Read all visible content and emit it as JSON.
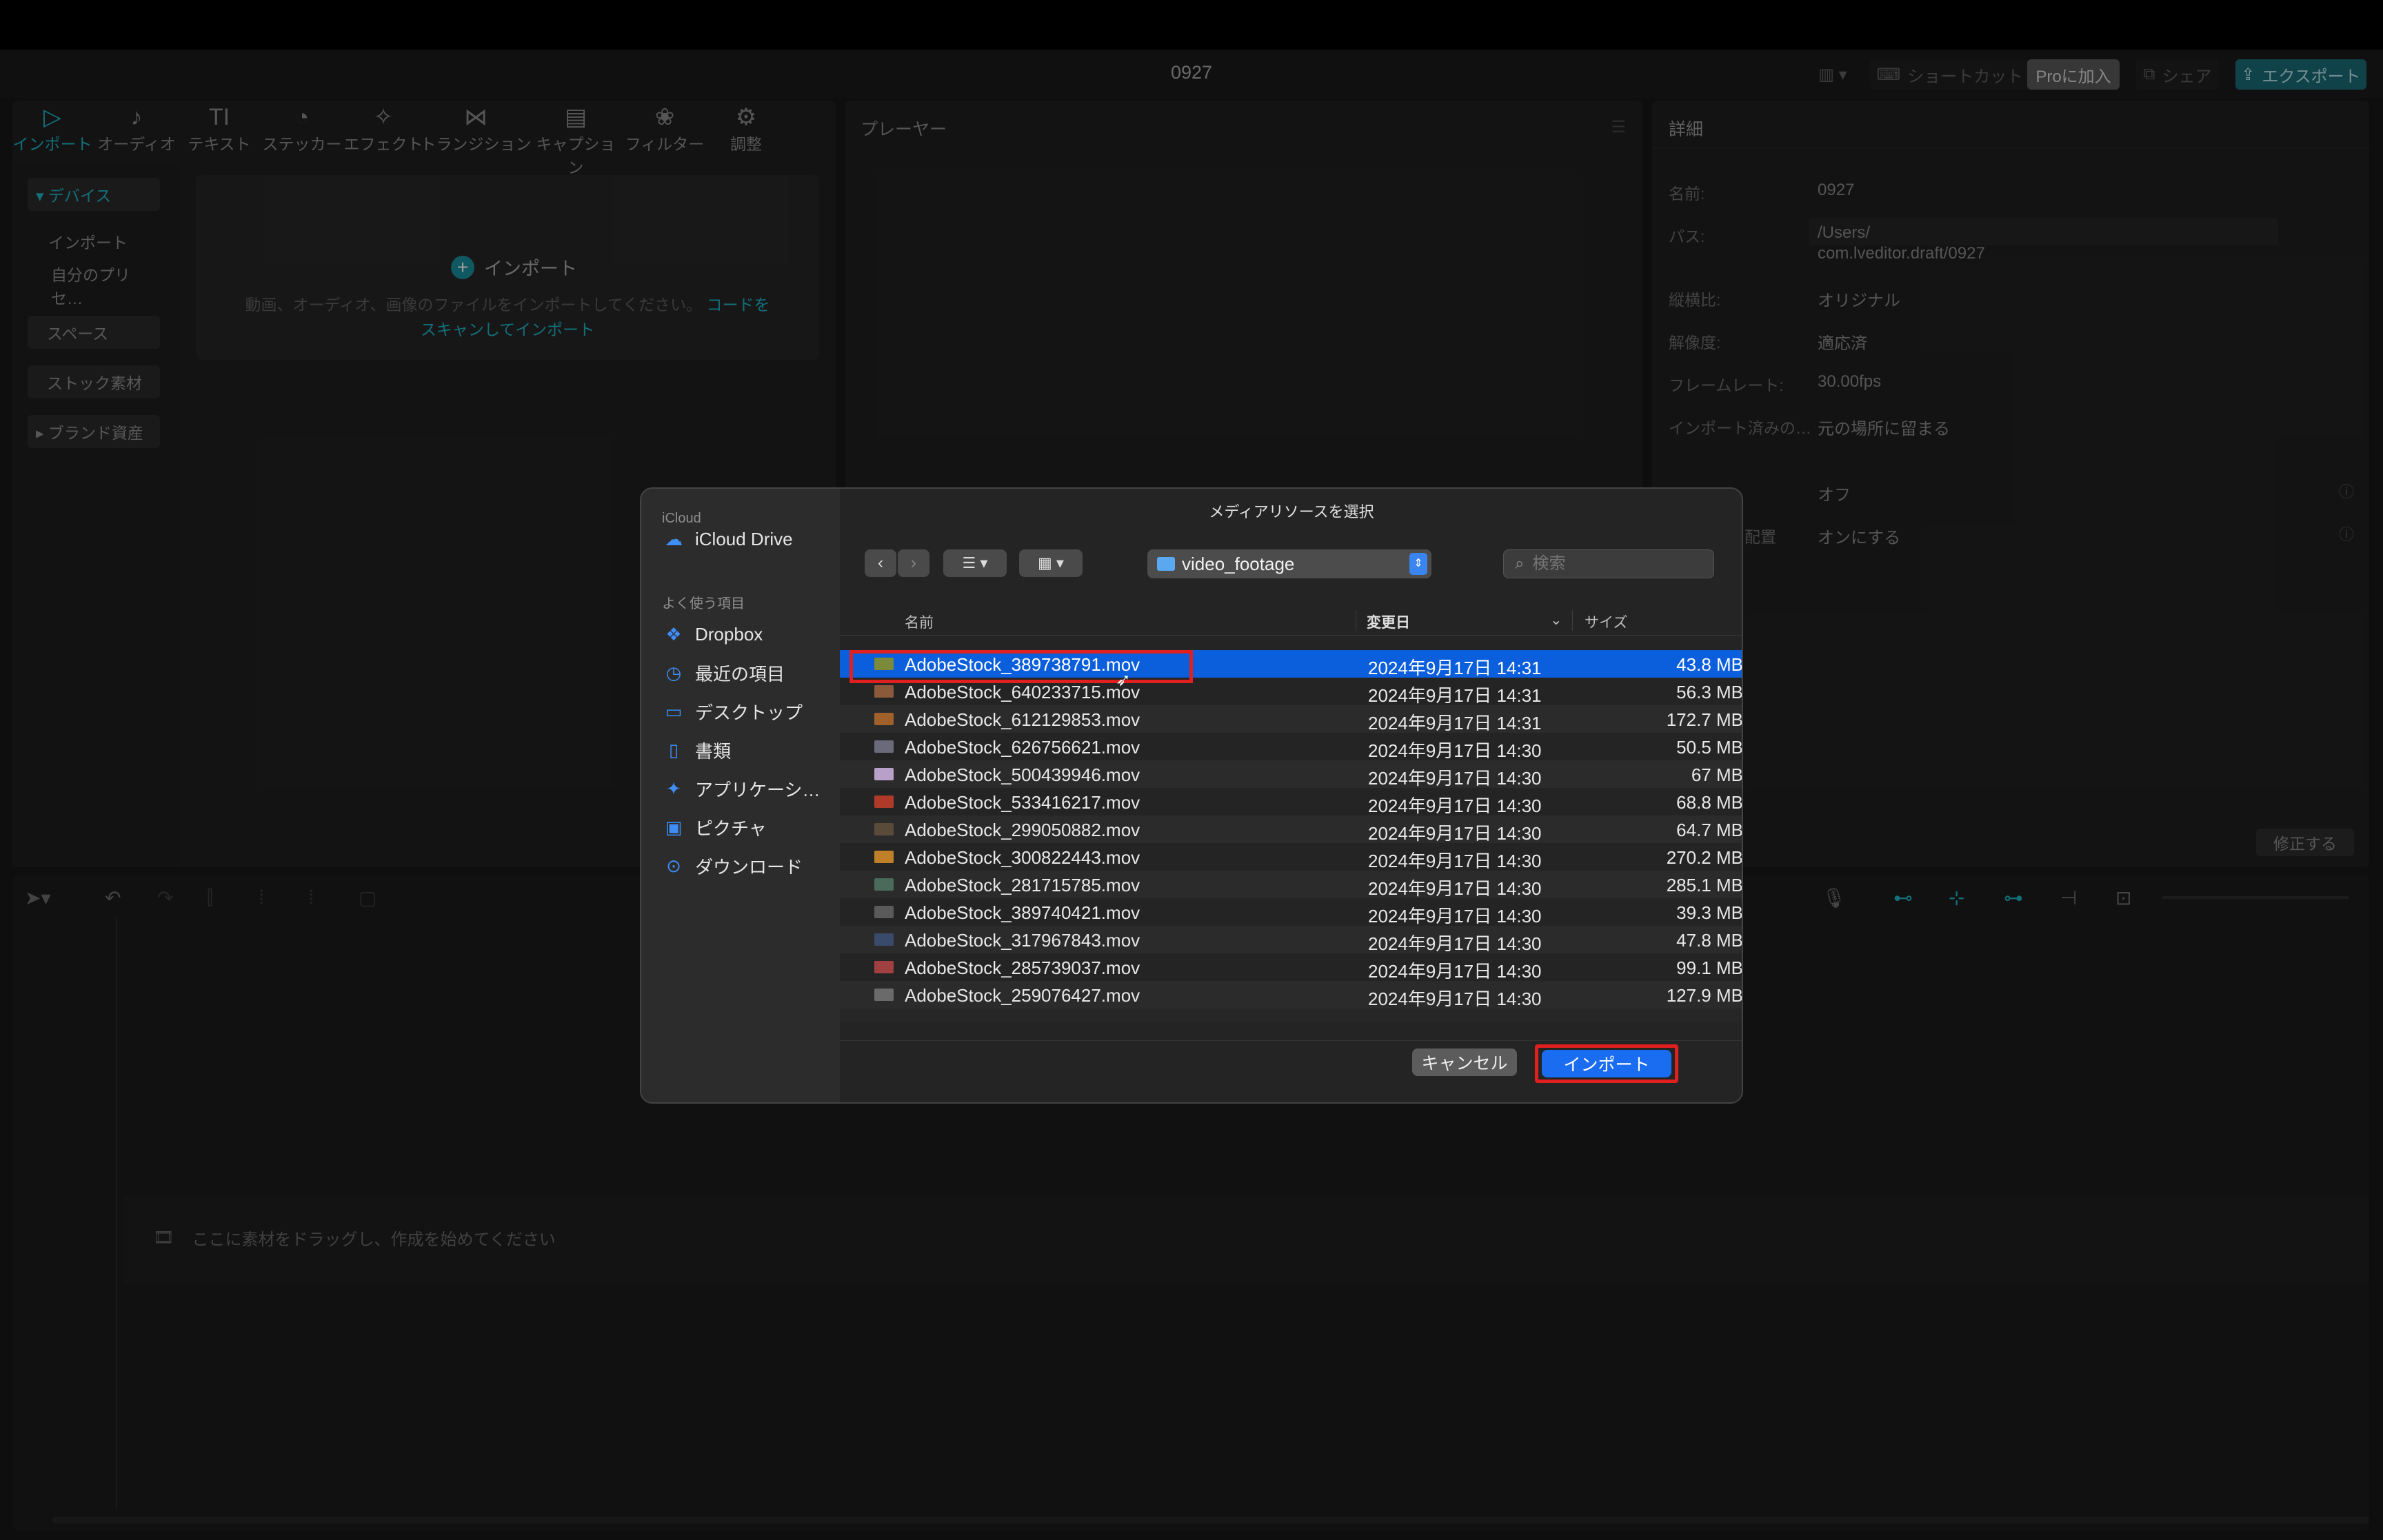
{
  "window": {
    "title": "0927"
  },
  "header": {
    "layout_icon": "layout-icon",
    "shortcut_label": "ショートカット",
    "pro_label": "Proに加入",
    "share_label": "シェア",
    "export_label": "エクスポート"
  },
  "toolbar": {
    "tools": [
      {
        "label": "インポート",
        "icon": "▷"
      },
      {
        "label": "オーディオ",
        "icon": "♪"
      },
      {
        "label": "テキスト",
        "icon": "TI"
      },
      {
        "label": "ステッカー",
        "icon": "◔"
      },
      {
        "label": "エフェクト",
        "icon": "✧"
      },
      {
        "label": "トランジション",
        "icon": "⋈"
      },
      {
        "label": "キャプション",
        "icon": "▤"
      },
      {
        "label": "フィルター",
        "icon": "❀"
      },
      {
        "label": "調整",
        "icon": "⚙"
      }
    ]
  },
  "sidebar": {
    "items": [
      {
        "label": "▾ デバイス"
      },
      {
        "label": "インポート"
      },
      {
        "label": "自分のプリセ…"
      },
      {
        "label": "スペース"
      },
      {
        "label": "ストック素材"
      },
      {
        "label": "▸ ブランド資産"
      }
    ]
  },
  "import_area": {
    "button_label": "インポート",
    "hint": "動画、オーディオ、画像のファイルをインポートしてください。",
    "link": "コードをスキャンしてインポート"
  },
  "player": {
    "title": "プレーヤー"
  },
  "details": {
    "title": "詳細",
    "rows": [
      {
        "label": "名前:",
        "value": "0927"
      },
      {
        "label": "パス:",
        "value": "/Users/",
        "value2": "com.lveditor.draft/0927"
      },
      {
        "label": "縦横比:",
        "value": "オリジナル"
      },
      {
        "label": "解像度:",
        "value": "適応済"
      },
      {
        "label": "フレームレート:",
        "value": "30.00fps"
      },
      {
        "label": "インポート済みの…",
        "value": "元の場所に留まる"
      },
      {
        "label": "",
        "value": "オフ"
      },
      {
        "label": "配置",
        "value": "オンにする"
      }
    ],
    "modify_label": "修正する"
  },
  "timeline": {
    "drop_hint": "ここに素材をドラッグし、作成を始めてください"
  },
  "dialog": {
    "title": "メディアリソースを選択",
    "side": {
      "icloud_header": "iCloud",
      "icloud_drive": "iCloud Drive",
      "favorites_header": "よく使う項目",
      "favorites": [
        {
          "label": "Dropbox",
          "icon": "dropbox-icon",
          "glyph": "❖"
        },
        {
          "label": "最近の項目",
          "icon": "clock-icon",
          "glyph": "◷"
        },
        {
          "label": "デスクトップ",
          "icon": "desktop-icon",
          "glyph": "▭"
        },
        {
          "label": "書類",
          "icon": "document-icon",
          "glyph": "▯"
        },
        {
          "label": "アプリケーシ…",
          "icon": "applications-icon",
          "glyph": "✦"
        },
        {
          "label": "ピクチャ",
          "icon": "pictures-icon",
          "glyph": "▣"
        },
        {
          "label": "ダウンロード",
          "icon": "download-icon",
          "glyph": "⊙"
        }
      ]
    },
    "folder": "video_footage",
    "search_placeholder": "検索",
    "columns": {
      "name": "名前",
      "date": "変更日",
      "size": "サイズ"
    },
    "files": [
      {
        "name": "AdobeStock_389738791.mov",
        "date": "2024年9月17日 14:31",
        "size": "43.8 MB",
        "color": "#7a8a3a"
      },
      {
        "name": "AdobeStock_640233715.mov",
        "date": "2024年9月17日 14:31",
        "size": "56.3 MB",
        "color": "#8a5a3a"
      },
      {
        "name": "AdobeStock_612129853.mov",
        "date": "2024年9月17日 14:31",
        "size": "172.7 MB",
        "color": "#a0602a"
      },
      {
        "name": "AdobeStock_626756621.mov",
        "date": "2024年9月17日 14:30",
        "size": "50.5 MB",
        "color": "#6a6a7a"
      },
      {
        "name": "AdobeStock_500439946.mov",
        "date": "2024年9月17日 14:30",
        "size": "67 MB",
        "color": "#b8a0c8"
      },
      {
        "name": "AdobeStock_533416217.mov",
        "date": "2024年9月17日 14:30",
        "size": "68.8 MB",
        "color": "#b03a2a"
      },
      {
        "name": "AdobeStock_299050882.mov",
        "date": "2024年9月17日 14:30",
        "size": "64.7 MB",
        "color": "#5a4a3a"
      },
      {
        "name": "AdobeStock_300822443.mov",
        "date": "2024年9月17日 14:30",
        "size": "270.2 MB",
        "color": "#c0802a"
      },
      {
        "name": "AdobeStock_281715785.mov",
        "date": "2024年9月17日 14:30",
        "size": "285.1 MB",
        "color": "#4a6a5a"
      },
      {
        "name": "AdobeStock_389740421.mov",
        "date": "2024年9月17日 14:30",
        "size": "39.3 MB",
        "color": "#5a5a5a"
      },
      {
        "name": "AdobeStock_317967843.mov",
        "date": "2024年9月17日 14:30",
        "size": "47.8 MB",
        "color": "#3a4a6a"
      },
      {
        "name": "AdobeStock_285739037.mov",
        "date": "2024年9月17日 14:30",
        "size": "99.1 MB",
        "color": "#a04040"
      },
      {
        "name": "AdobeStock_259076427.mov",
        "date": "2024年9月17日 14:30",
        "size": "127.9 MB",
        "color": "#6a6a6a"
      }
    ],
    "cancel_label": "キャンセル",
    "import_label": "インポート"
  },
  "colors": {
    "accent": "#1fb4c6",
    "selection": "#0c5fdc",
    "highlight": "#e01f1f"
  }
}
